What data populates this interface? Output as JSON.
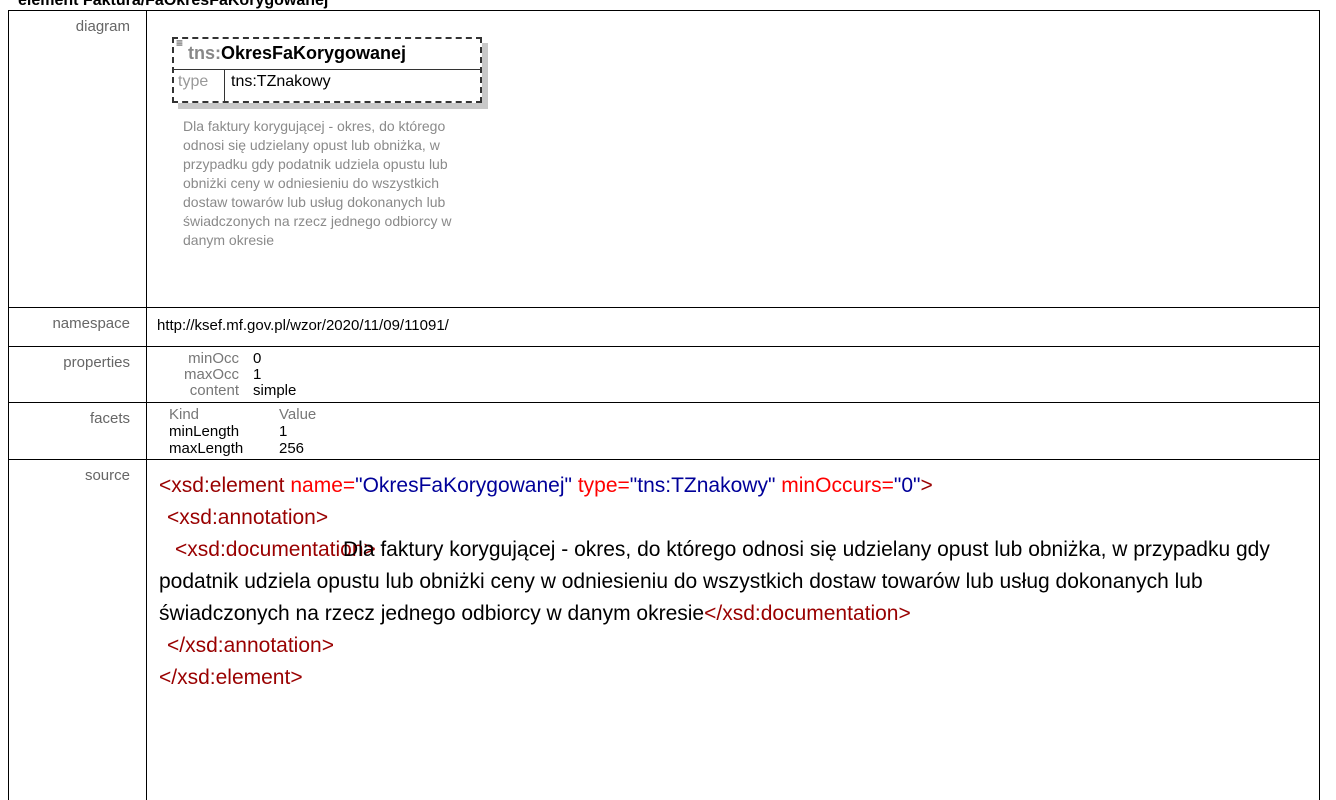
{
  "header": {
    "title": "element Faktura/FaOkresFaKorygowanej"
  },
  "rows": {
    "diagram_label": "diagram",
    "namespace_label": "namespace",
    "properties_label": "properties",
    "facets_label": "facets",
    "source_label": "source"
  },
  "diagram": {
    "icon": "list-icon",
    "prefix": "tns:",
    "name": "OkresFaKorygowanej",
    "type_label": "type",
    "type_value": "tns:TZnakowy",
    "documentation": "Dla faktury korygującej - okres, do którego odnosi się udzielany opust lub obniżka, w przypadku gdy podatnik udziela opustu lub obniżki ceny w odniesieniu do wszystkich dostaw towarów lub usług dokonanych lub świadczonych na rzecz jednego odbiorcy w danym okresie"
  },
  "namespace": {
    "value": "http://ksef.mf.gov.pl/wzor/2020/11/09/11091/"
  },
  "properties": [
    {
      "key": "minOcc",
      "value": "0"
    },
    {
      "key": "maxOcc",
      "value": "1"
    },
    {
      "key": "content",
      "value": "simple"
    }
  ],
  "facets": {
    "headers": [
      "Kind",
      "Value"
    ],
    "rows": [
      {
        "kind": "minLength",
        "value": "1"
      },
      {
        "kind": "maxLength",
        "value": "256"
      }
    ]
  },
  "source": {
    "open_tag": "<xsd:element",
    "attr_name": "name=",
    "attr_name_val": "\"OkresFaKorygowanej\"",
    "attr_type": "type=",
    "attr_type_val": "\"tns:TZnakowy\"",
    "attr_min": "minOccurs=",
    "attr_min_val": "\"0\"",
    "open_close": ">",
    "annotation_open": "<xsd:annotation>",
    "documentation_open": "<xsd:documentation>",
    "documentation_text": "Dla faktury korygującej - okres, do którego odnosi się udzielany opust lub obniżka, w przypadku gdy podatnik udziela opustu lub obniżki ceny w odniesieniu do wszystkich dostaw towarów lub usług dokonanych lub świadczonych na rzecz jednego odbiorcy w danym okresie",
    "documentation_close": "</xsd:documentation>",
    "annotation_close": "</xsd:annotation>",
    "element_close": "</xsd:element>"
  }
}
